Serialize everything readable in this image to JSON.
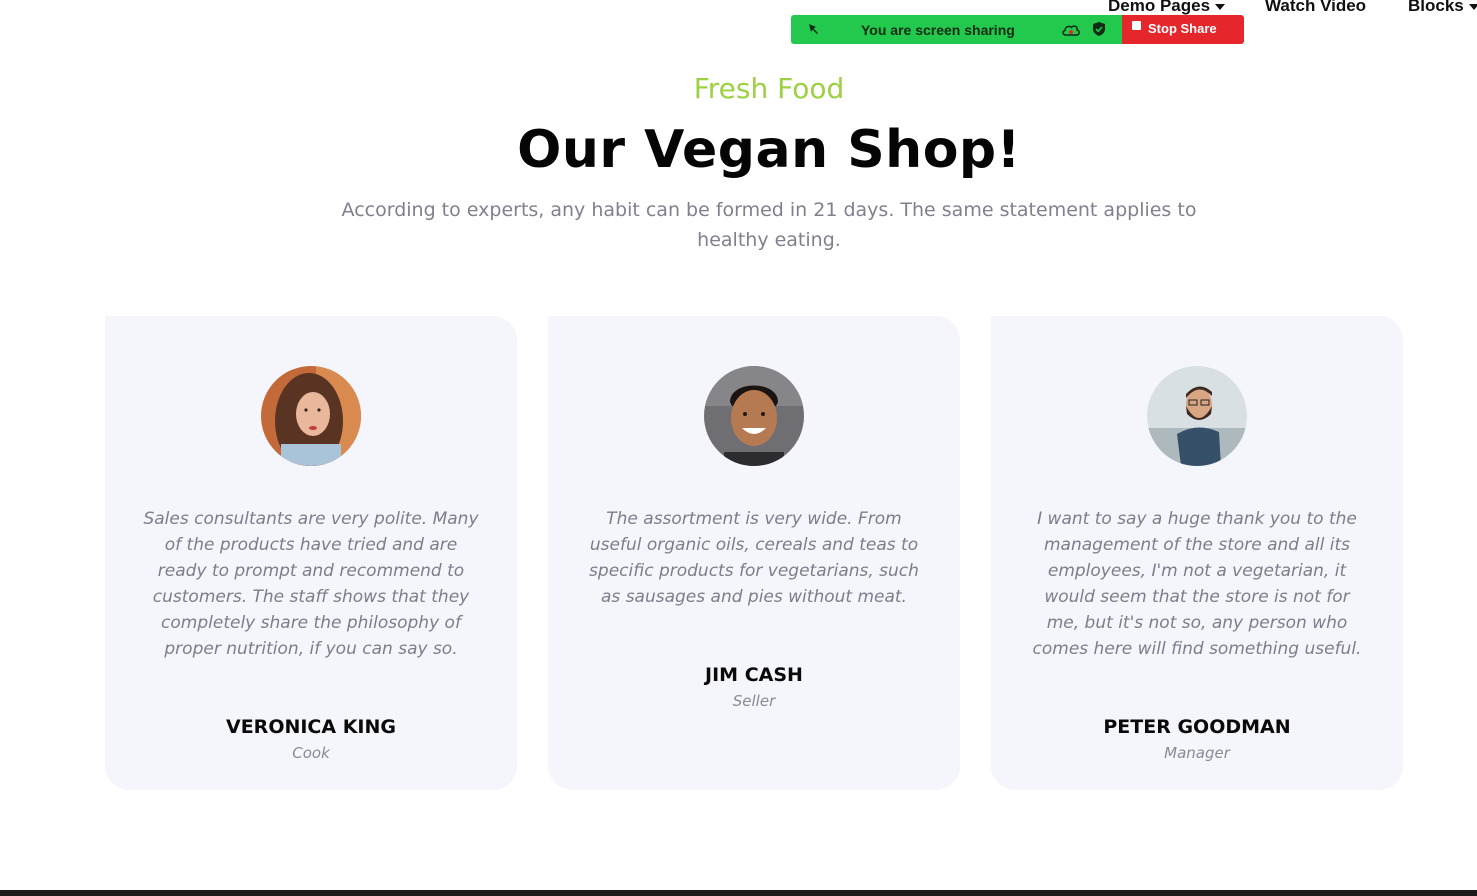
{
  "nav": {
    "demo_pages": "Demo Pages",
    "watch_video": "Watch Video",
    "blocks": "Blocks"
  },
  "share_bar": {
    "status": "You are screen sharing",
    "stop_label": "Stop Share",
    "colors": {
      "bar": "#22c94d",
      "stop": "#e5262b"
    }
  },
  "section": {
    "eyebrow": "Fresh Food",
    "title": "Our Vegan Shop!",
    "subtitle": "According to experts, any habit can be formed in 21 days. The same statement applies to healthy eating.",
    "colors": {
      "eyebrow": "#9ed044",
      "card_bg": "#f5f6fb"
    }
  },
  "testimonials": [
    {
      "quote": "Sales consultants are very polite. Many of the products have tried and are ready to prompt and recommend to customers. The staff shows that they completely share the philosophy of proper nutrition, if you can say so.",
      "name": "VERONICA KING",
      "role": "Cook"
    },
    {
      "quote": "The assortment is very wide. From useful organic oils, cereals and teas to specific products for vegetarians, such as sausages and pies without meat.",
      "name": "JIM CASH",
      "role": "Seller"
    },
    {
      "quote": "I want to say a huge thank you to the management of the store and all its employees, I'm not a vegetarian, it would seem that the store is not for me, but it's not so, any person who comes here will find something useful.",
      "name": "PETER GOODMAN",
      "role": "Manager"
    }
  ]
}
